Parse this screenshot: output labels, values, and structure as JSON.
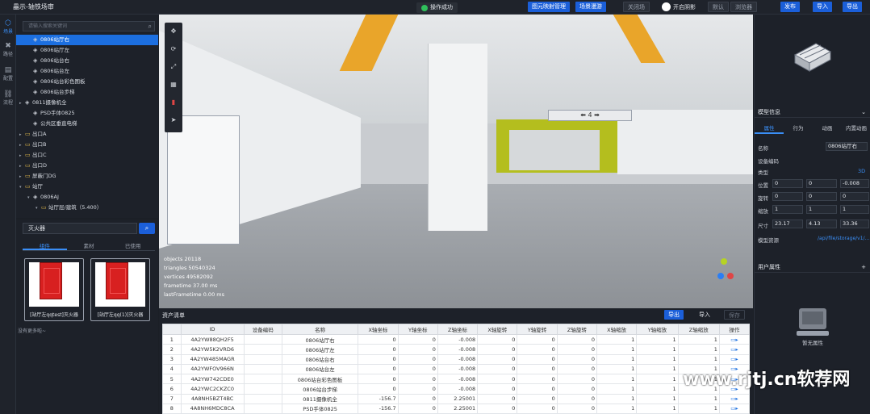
{
  "app": {
    "title": "畾示-轴铁场审"
  },
  "topbar": {
    "toast": "操作成功",
    "btn_model_manage": "图元映射管理",
    "btn_scene_roam": "场景漫游",
    "btn_disabled": "关闭场",
    "toggle_label": "开启阴影",
    "btn_default": "默认",
    "btn_theme": "浏览器",
    "btn_publish": "发布",
    "btn_import": "导入",
    "btn_export": "导出"
  },
  "rail": {
    "items": [
      {
        "label": "场景"
      },
      {
        "label": "路径"
      },
      {
        "label": "配置"
      },
      {
        "label": "流程"
      }
    ]
  },
  "tree": {
    "search_placeholder": "请输入搜索关键词",
    "rows": [
      {
        "label": "0806站厅右",
        "selected": true,
        "indent": 1,
        "arrow": "",
        "folder": false
      },
      {
        "label": "0806站厅左",
        "indent": 1,
        "arrow": "",
        "folder": false
      },
      {
        "label": "0806站台右",
        "indent": 1,
        "arrow": "",
        "folder": false
      },
      {
        "label": "0806站台左",
        "indent": 1,
        "arrow": "",
        "folder": false
      },
      {
        "label": "0806站台彩色图板",
        "indent": 1,
        "arrow": "",
        "folder": false
      },
      {
        "label": "0806站台步梯",
        "indent": 1,
        "arrow": "",
        "folder": false
      },
      {
        "label": "0811摄像机全",
        "indent": 0,
        "arrow": "▸",
        "folder": false
      },
      {
        "label": "PSD手体0825",
        "indent": 1,
        "arrow": "",
        "folder": false
      },
      {
        "label": "公共区垂直电梯",
        "indent": 1,
        "arrow": "",
        "folder": false
      },
      {
        "label": "出口A",
        "indent": 0,
        "arrow": "▸",
        "folder": true
      },
      {
        "label": "出口B",
        "indent": 0,
        "arrow": "▸",
        "folder": true
      },
      {
        "label": "出口C",
        "indent": 0,
        "arrow": "▸",
        "folder": true
      },
      {
        "label": "出口D",
        "indent": 0,
        "arrow": "▸",
        "folder": true
      },
      {
        "label": "屏蔽门DG",
        "indent": 0,
        "arrow": "▸",
        "folder": true
      },
      {
        "label": "站厅",
        "indent": 0,
        "arrow": "▾",
        "folder": true
      },
      {
        "label": "0806AJ",
        "indent": 1,
        "arrow": "▾",
        "folder": false
      },
      {
        "label": "站厅层/建筑（5.400）",
        "indent": 2,
        "arrow": "▾",
        "folder": true
      }
    ]
  },
  "assets": {
    "search_value": "灭火器",
    "tabs": [
      "组件",
      "素材",
      "已使用"
    ],
    "cards": [
      {
        "caption": "[站厅左qqtest]灭火器"
      },
      {
        "caption": "[站厅左qq(1)]灭火器"
      }
    ],
    "no_more": "没有更多啦~"
  },
  "viewport": {
    "sign_text": "⬅ 4 ➡",
    "stats": [
      "objects  20118",
      "triangles  50540324",
      "vertices  49582092",
      "frametime  37.00 ms",
      "lastFrametime  0.00 ms"
    ],
    "tool_icons": [
      "move-icon",
      "rotate-icon",
      "scale-icon",
      "grid-icon",
      "fire-extinguisher-icon",
      "send-icon"
    ]
  },
  "table": {
    "title": "资产清单",
    "btn_export": "导出",
    "btn_import": "导入",
    "btn_save": "保存",
    "columns": [
      "",
      "ID",
      "设备编码",
      "名称",
      "X轴坐标",
      "Y轴坐标",
      "Z轴坐标",
      "X轴旋转",
      "Y轴旋转",
      "Z轴旋转",
      "X轴缩放",
      "Y轴缩放",
      "Z轴缩放",
      "操作"
    ],
    "rows": [
      {
        "n": "1",
        "id": "4A2YW88QH2F5",
        "code": "",
        "name": "0806站厅右",
        "x": "0",
        "y": "0",
        "z": "-0.008",
        "rx": "0",
        "ry": "0",
        "rz": "0",
        "sx": "1",
        "sy": "1",
        "sz": "1"
      },
      {
        "n": "2",
        "id": "4A2YW5K2VRD6",
        "code": "",
        "name": "0806站厅左",
        "x": "0",
        "y": "0",
        "z": "-0.008",
        "rx": "0",
        "ry": "0",
        "rz": "0",
        "sx": "1",
        "sy": "1",
        "sz": "1"
      },
      {
        "n": "3",
        "id": "4A2YW485MAGR",
        "code": "",
        "name": "0806站台右",
        "x": "0",
        "y": "0",
        "z": "-0.008",
        "rx": "0",
        "ry": "0",
        "rz": "0",
        "sx": "1",
        "sy": "1",
        "sz": "1"
      },
      {
        "n": "4",
        "id": "4A2YWFOV966N",
        "code": "",
        "name": "0806站台左",
        "x": "0",
        "y": "0",
        "z": "-0.008",
        "rx": "0",
        "ry": "0",
        "rz": "0",
        "sx": "1",
        "sy": "1",
        "sz": "1"
      },
      {
        "n": "5",
        "id": "4A2YW742CDE0",
        "code": "",
        "name": "0806站台彩色图板",
        "x": "0",
        "y": "0",
        "z": "-0.008",
        "rx": "0",
        "ry": "0",
        "rz": "0",
        "sx": "1",
        "sy": "1",
        "sz": "1"
      },
      {
        "n": "6",
        "id": "4A2YWC2CKZC0",
        "code": "",
        "name": "0806站台步梯",
        "x": "0",
        "y": "0",
        "z": "-0.008",
        "rx": "0",
        "ry": "0",
        "rz": "0",
        "sx": "1",
        "sy": "1",
        "sz": "1"
      },
      {
        "n": "7",
        "id": "4A8NH5BZT4BC",
        "code": "",
        "name": "0811摄像机全",
        "x": "-156.7",
        "y": "0",
        "z": "2.25001",
        "rx": "0",
        "ry": "0",
        "rz": "0",
        "sx": "1",
        "sy": "1",
        "sz": "1"
      },
      {
        "n": "8",
        "id": "4A8NH6MDC8CA",
        "code": "",
        "name": "PSD手体0825",
        "x": "-156.7",
        "y": "0",
        "z": "2.25001",
        "rx": "0",
        "ry": "0",
        "rz": "0",
        "sx": "1",
        "sy": "1",
        "sz": "1"
      }
    ]
  },
  "right": {
    "model_info_title": "模型信息",
    "tabs": [
      "属性",
      "行为",
      "动画",
      "内置动画"
    ],
    "name_label": "名称",
    "name_value": "0806站厅右",
    "code_label": "设备编码",
    "type_label": "类型",
    "type_value": "3D",
    "position_label": "位置",
    "position": [
      "0",
      "0",
      "-0.008"
    ],
    "rotation_label": "旋转",
    "rotation": [
      "0",
      "0",
      "0"
    ],
    "scale_label": "缩放",
    "scale": [
      "1",
      "1",
      "1"
    ],
    "size_label": "尺寸",
    "size": [
      "23.17",
      "4.13",
      "33.36"
    ],
    "resource_label": "模型资源",
    "resource_value": "/api/file/storage/v1/...",
    "user_props_title": "用户属性",
    "user_empty": "暂无属性"
  },
  "watermark": "www.rjtj.cn软荐网",
  "colors": {
    "accent": "#1b5fd9",
    "selected": "#1c6fe0",
    "panel": "#1d2129",
    "beam": "#e9a52a",
    "gate": "#b4be1e"
  }
}
